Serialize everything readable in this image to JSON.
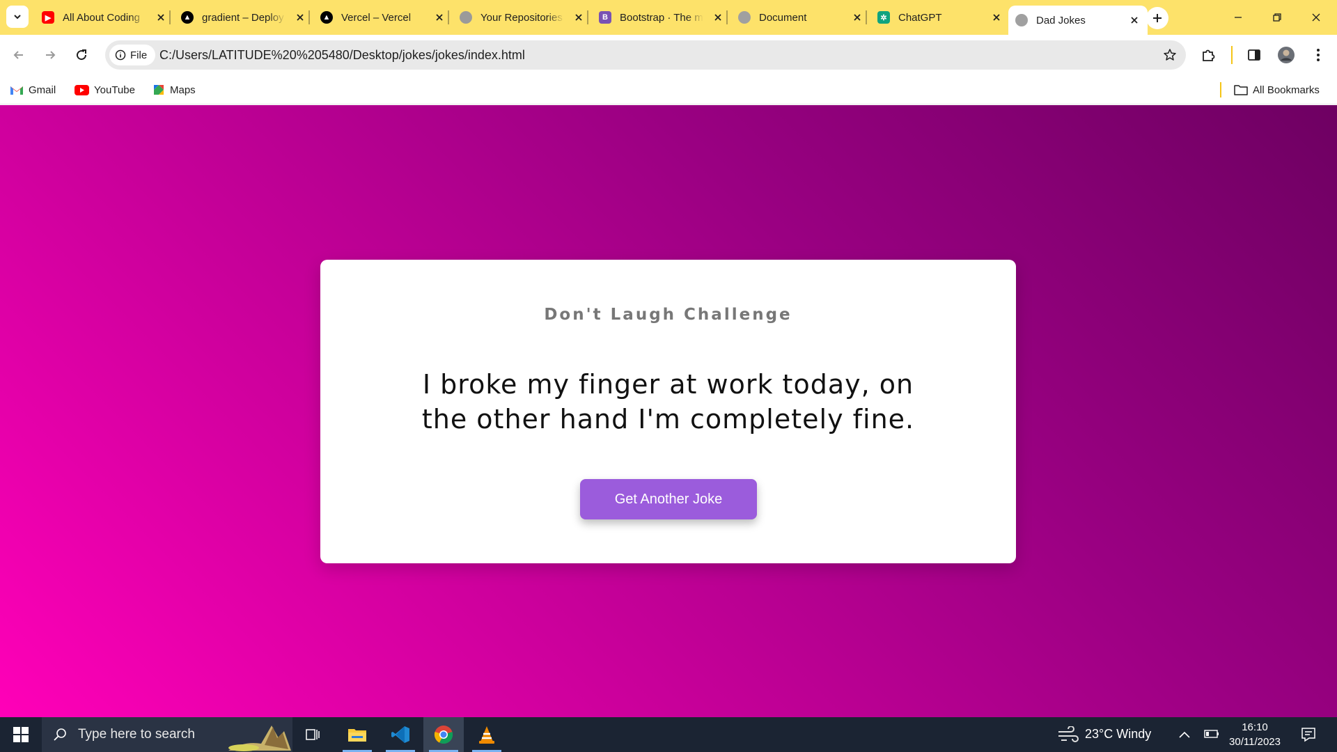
{
  "tabs": [
    {
      "title": "All About Coding",
      "favicon": "youtube-icon",
      "color": "#ff0000"
    },
    {
      "title": "gradient – Deploy",
      "favicon": "vercel-icon",
      "color": "#000000"
    },
    {
      "title": "Vercel – Vercel",
      "favicon": "vercel-icon",
      "color": "#000000"
    },
    {
      "title": "Your Repositories",
      "favicon": "github-icon",
      "color": "#8a8a8a"
    },
    {
      "title": "Bootstrap · The most",
      "favicon": "bootstrap-icon",
      "color": "#7952b3"
    },
    {
      "title": "Document",
      "favicon": "globe-icon",
      "color": "#8a8a8a"
    },
    {
      "title": "ChatGPT",
      "favicon": "chatgpt-icon",
      "color": "#10a37f"
    },
    {
      "title": "Dad Jokes",
      "favicon": "globe-icon",
      "color": "#8a8a8a",
      "active": true
    }
  ],
  "omnibox": {
    "chip_label": "File",
    "url": "C:/Users/LATITUDE%20%205480/Desktop/jokes/jokes/index.html"
  },
  "bookmarks": {
    "items": [
      {
        "label": "Gmail",
        "icon": "gmail-icon"
      },
      {
        "label": "YouTube",
        "icon": "youtube-icon"
      },
      {
        "label": "Maps",
        "icon": "maps-icon"
      }
    ],
    "all_label": "All Bookmarks"
  },
  "page": {
    "heading": "Don't Laugh Challenge",
    "joke": "I broke my finger at work today, on the other hand I'm completely fine.",
    "button_label": "Get Another Joke",
    "colors": {
      "gradient_dark": "#6e0062",
      "gradient_light": "#ff00b8",
      "button": "#9b5cdc"
    }
  },
  "taskbar": {
    "search_placeholder": "Type here to search",
    "weather": "23°C  Windy",
    "time": "16:10",
    "date": "30/11/2023"
  },
  "colors": {
    "tabstrip": "#fde26a",
    "taskbar": "#1b2433"
  }
}
